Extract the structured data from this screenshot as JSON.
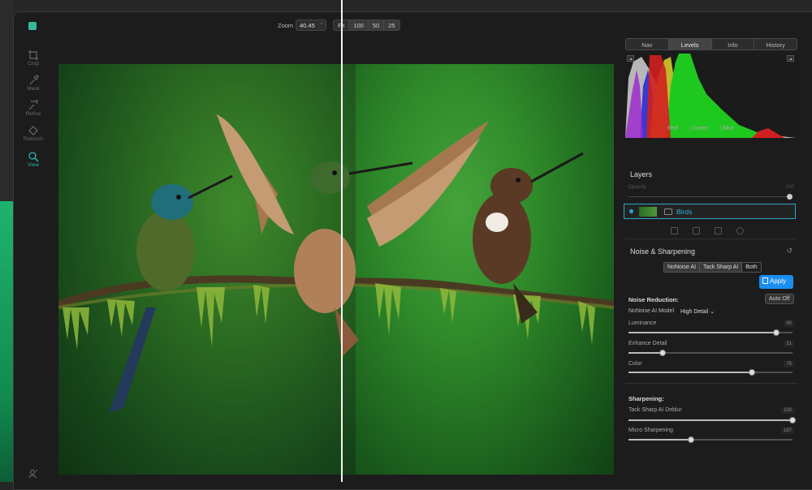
{
  "toolbar": {
    "zoom_label": "Zoom",
    "zoom_value": "40.45",
    "presets": [
      "Fit",
      "100",
      "50",
      "25"
    ]
  },
  "tools": [
    {
      "label": "Crop",
      "icon": "crop-icon"
    },
    {
      "label": "Mask",
      "icon": "mask-brush-icon"
    },
    {
      "label": "Refine",
      "icon": "refine-brush-icon"
    },
    {
      "label": "Retouch",
      "icon": "retouch-icon"
    },
    {
      "label": "View",
      "icon": "view-zoom-icon",
      "active": true
    }
  ],
  "panel": {
    "tabs": [
      "Nav",
      "Levels",
      "Info",
      "History"
    ],
    "active_tab": "Levels",
    "histogram_channels": [
      "Red",
      "| Green",
      "| Blue"
    ],
    "layers_title": "Layers",
    "opacity_label": "Opacity",
    "opacity_value": "100",
    "opacity_level": 100,
    "layer_name": "Birds"
  },
  "noise_sharpening": {
    "title": "Noise & Sharpening",
    "modes": [
      "NoNoise AI",
      "Tack Sharp AI",
      "Both"
    ],
    "active_mode": "Both",
    "apply_label": "Apply",
    "noise_reduction_title": "Noise Reduction:",
    "auto_label": "Auto Off",
    "model_label": "NoNoise AI Model",
    "model_value": "High Detail",
    "sliders": [
      {
        "label": "Luminance",
        "value": "90",
        "level": 90
      },
      {
        "label": "Enhance Detail",
        "value": "21",
        "level": 21
      },
      {
        "label": "Color",
        "value": "75",
        "level": 75
      }
    ],
    "sharpening_title": "Sharpening:",
    "sharp_sliders": [
      {
        "label": "Tack Sharp AI Deblur",
        "value": "100",
        "level": 100
      },
      {
        "label": "Micro Sharpening",
        "value": "187",
        "level": 38
      }
    ]
  },
  "colors": {
    "accent": "#2aa9c9",
    "apply_blue": "#1a8ef0",
    "active_tool": "#2bb6b1"
  }
}
